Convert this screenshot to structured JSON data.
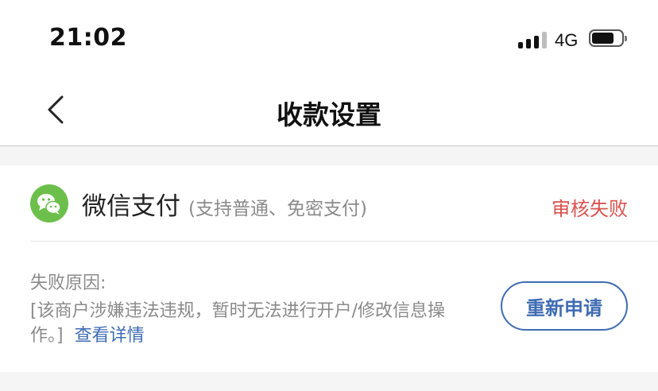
{
  "status_bar": {
    "time": "21:02",
    "network": "4G",
    "battery_level": 0.75
  },
  "nav": {
    "title": "收款设置"
  },
  "payment": {
    "name": "微信支付",
    "description": "(支持普通、免密支付)",
    "status": "审核失败",
    "reason_label": "失败原因:",
    "reason_text": "[该商户涉嫌违法违规，暂时无法进行开户/修改信息操作。]",
    "details_link": "查看详情",
    "reapply_button": "重新申请"
  },
  "colors": {
    "brand_green": "#6cbf4b",
    "status_red": "#d9534f",
    "link_blue": "#3f6cb3"
  }
}
